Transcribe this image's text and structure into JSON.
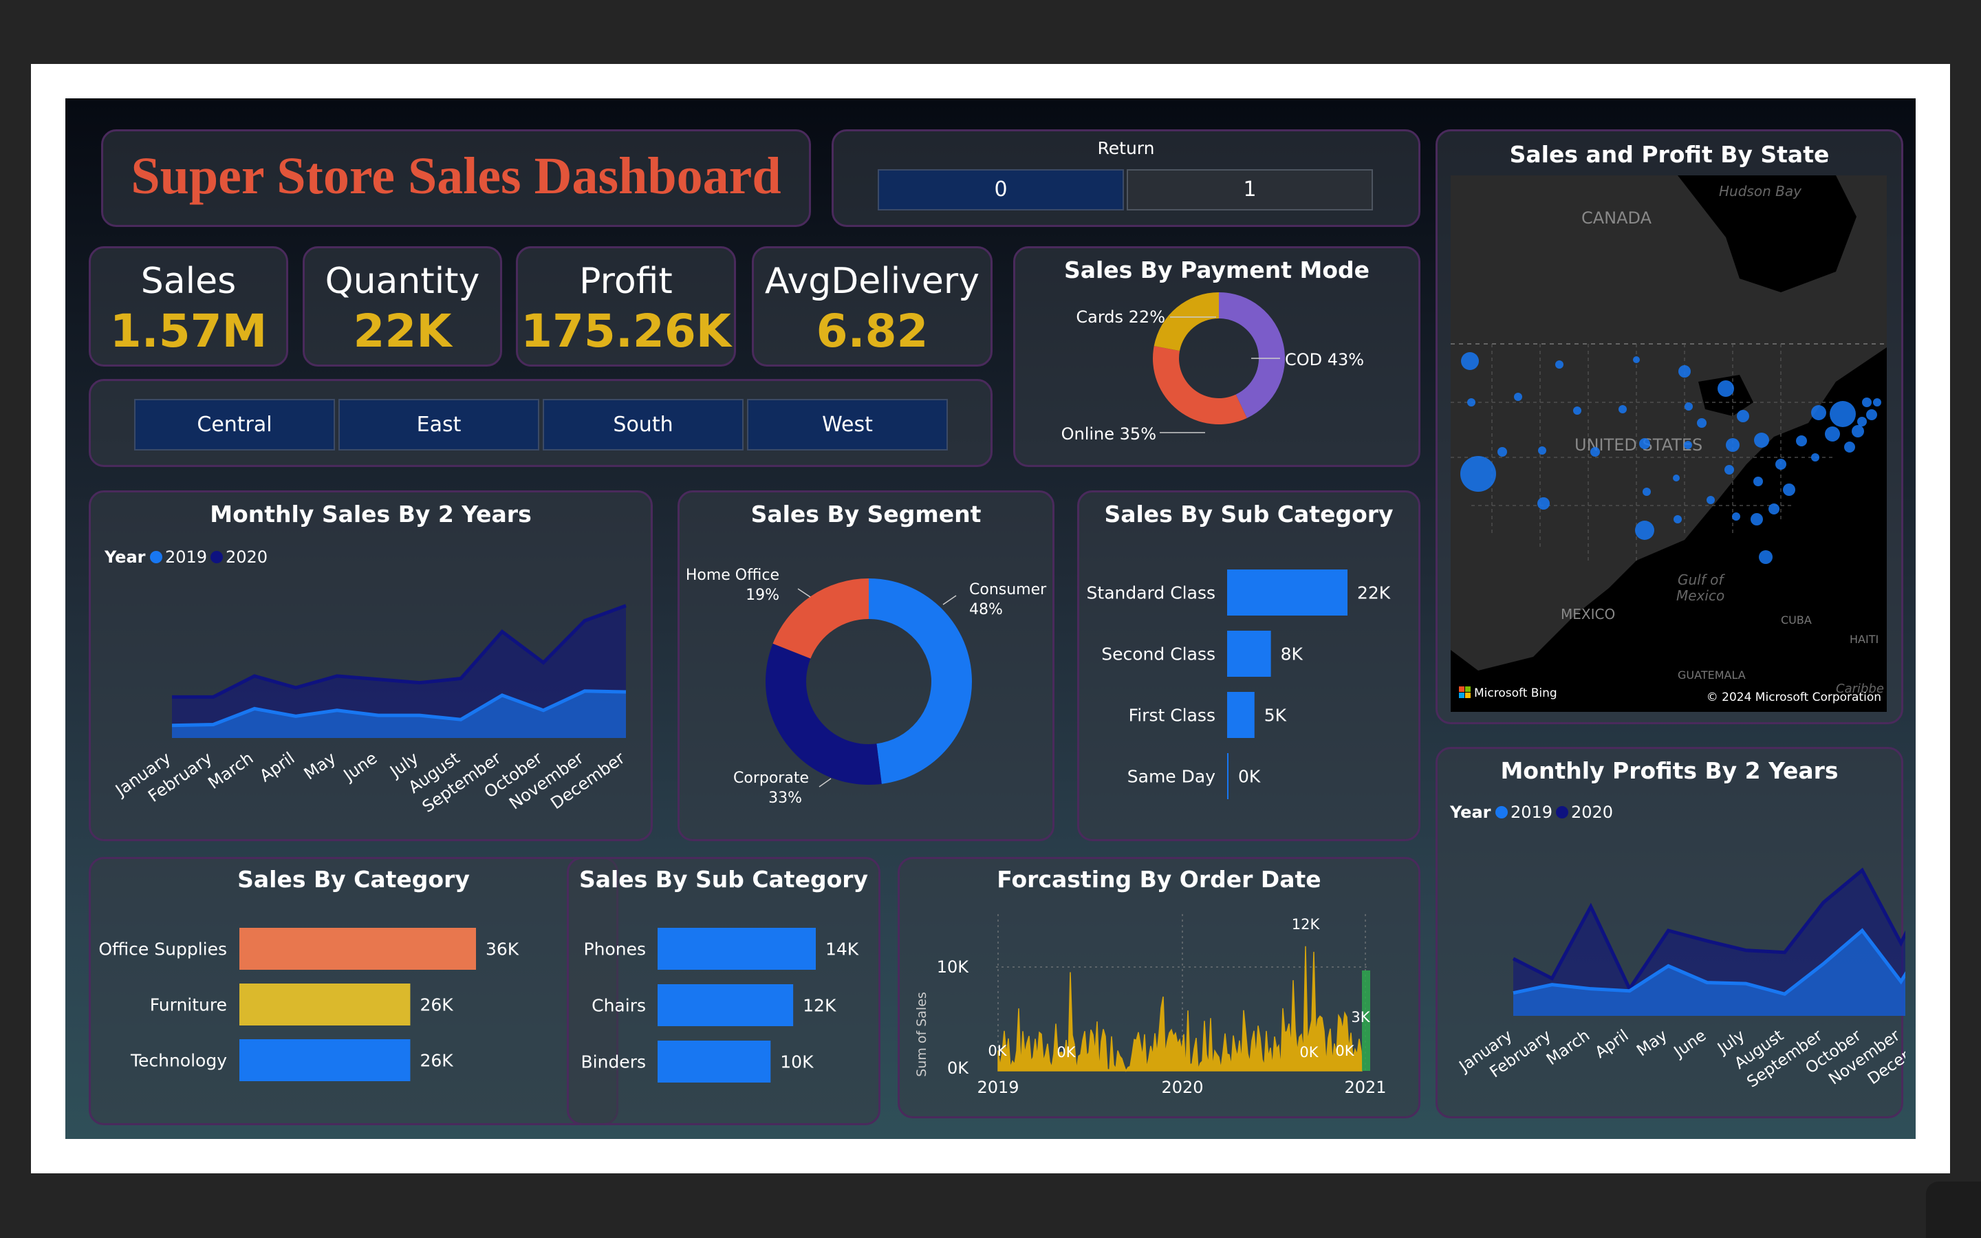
{
  "dashboard": {
    "title": "Super Store Sales Dashboard",
    "colors": {
      "accent_orange": "#e3553a",
      "kpi_gold": "#e0b21a",
      "blue": "#1877f2",
      "navy": "#0e1280",
      "slicer": "#0f2b5e",
      "border": "#4a2a5c"
    }
  },
  "return_slicer": {
    "label": "Return",
    "options": [
      "0",
      "1"
    ],
    "selected": "0"
  },
  "kpis": [
    {
      "label": "Sales",
      "value": "1.57M"
    },
    {
      "label": "Quantity",
      "value": "22K"
    },
    {
      "label": "Profit",
      "value": "175.26K"
    },
    {
      "label": "AvgDelivery",
      "value": "6.82"
    }
  ],
  "region_slicer": {
    "options": [
      "Central",
      "East",
      "South",
      "West"
    ]
  },
  "map": {
    "title": "Sales and Profit By State",
    "labels": [
      "Hudson Bay",
      "CANADA",
      "UNITED STATES",
      "Gulf of",
      "Mexico",
      "MEXICO",
      "CUBA",
      "HAITI",
      "GUATEMALA",
      "Caribbe"
    ],
    "attribution_left": "Microsoft Bing",
    "attribution_right": "© 2024 Microsoft Corporation"
  },
  "chart_data": [
    {
      "id": "payment",
      "type": "pie",
      "title": "Sales By Payment Mode",
      "slices": [
        {
          "label": "COD",
          "value": 43,
          "color": "#7b5cc9"
        },
        {
          "label": "Online",
          "value": 35,
          "color": "#e3553a"
        },
        {
          "label": "Cards",
          "value": 22,
          "color": "#d6a40c"
        }
      ],
      "labels": [
        "COD 43%",
        "Online 35%",
        "Cards 22%"
      ]
    },
    {
      "id": "monthly_sales",
      "type": "area",
      "title": "Monthly Sales By 2 Years",
      "legend_title": "Year",
      "categories": [
        "January",
        "February",
        "March",
        "April",
        "May",
        "June",
        "July",
        "August",
        "September",
        "October",
        "November",
        "December"
      ],
      "series": [
        {
          "name": "2019",
          "color": "#1877f2",
          "values": [
            15,
            16,
            35,
            26,
            33,
            27,
            27,
            22,
            51,
            33,
            56,
            55
          ]
        },
        {
          "name": "2020",
          "color": "#0e1280",
          "values": [
            49,
            49,
            74,
            60,
            74,
            70,
            66,
            71,
            127,
            90,
            140,
            158
          ]
        }
      ],
      "ylim": [
        0,
        170
      ]
    },
    {
      "id": "segment",
      "type": "pie",
      "title": "Sales By Segment",
      "slices": [
        {
          "label": "Consumer",
          "value": 48,
          "color": "#1877f2"
        },
        {
          "label": "Corporate",
          "value": 33,
          "color": "#0e1280"
        },
        {
          "label": "Home Office",
          "value": 19,
          "color": "#e3553a"
        }
      ],
      "labels": [
        {
          "line1": "Consumer",
          "line2": "48%"
        },
        {
          "line1": "Corporate",
          "line2": "33%"
        },
        {
          "line1": "Home Office",
          "line2": "19%"
        }
      ]
    },
    {
      "id": "ship_mode",
      "type": "bar",
      "title": "Sales By Sub Category",
      "categories": [
        "Standard Class",
        "Second Class",
        "First Class",
        "Same Day"
      ],
      "values": [
        22,
        8,
        5,
        0
      ],
      "value_labels": [
        "22K",
        "8K",
        "5K",
        "0K"
      ],
      "color": "#1877f2",
      "xlim": [
        0,
        22
      ]
    },
    {
      "id": "category",
      "type": "bar",
      "title": "Sales By Category",
      "categories": [
        "Office Supplies",
        "Furniture",
        "Technology"
      ],
      "values": [
        36,
        26,
        26
      ],
      "value_labels": [
        "36K",
        "26K",
        "26K"
      ],
      "colors": [
        "#e8774e",
        "#dbb92c",
        "#1877f2"
      ],
      "xlim": [
        0,
        36
      ]
    },
    {
      "id": "sub_category",
      "type": "bar",
      "title": "Sales By Sub Category",
      "categories": [
        "Phones",
        "Chairs",
        "Binders"
      ],
      "values": [
        14,
        12,
        10
      ],
      "value_labels": [
        "14K",
        "12K",
        "10K"
      ],
      "color": "#1877f2",
      "xlim": [
        0,
        14
      ]
    },
    {
      "id": "forecast",
      "type": "area",
      "title": "Forcasting By Order Date",
      "ylabel": "Sum of Sales",
      "x_ticks": [
        "2019",
        "2020",
        "2021"
      ],
      "y_ticks": [
        "0K",
        "10K"
      ],
      "annotations": [
        "12K",
        "0K",
        "0K",
        "0K",
        "0K",
        "3K"
      ],
      "color": "#d6a40c",
      "forecast_color": "#2fa84f",
      "ylim": [
        0,
        12
      ]
    },
    {
      "id": "monthly_profits",
      "type": "area",
      "title": "Monthly Profits By 2 Years",
      "legend_title": "Year",
      "categories": [
        "January",
        "February",
        "March",
        "April",
        "May",
        "June",
        "July",
        "August",
        "September",
        "October",
        "November",
        "December"
      ],
      "series": [
        {
          "name": "2019",
          "color": "#1877f2",
          "values": [
            22,
            30,
            26,
            24,
            48,
            32,
            31,
            21,
            50,
            82,
            33,
            93
          ]
        },
        {
          "name": "2020",
          "color": "#0e1280",
          "values": [
            55,
            36,
            105,
            26,
            82,
            72,
            63,
            61,
            109,
            140,
            70,
            145
          ]
        }
      ],
      "ylim": [
        0,
        160
      ]
    }
  ]
}
